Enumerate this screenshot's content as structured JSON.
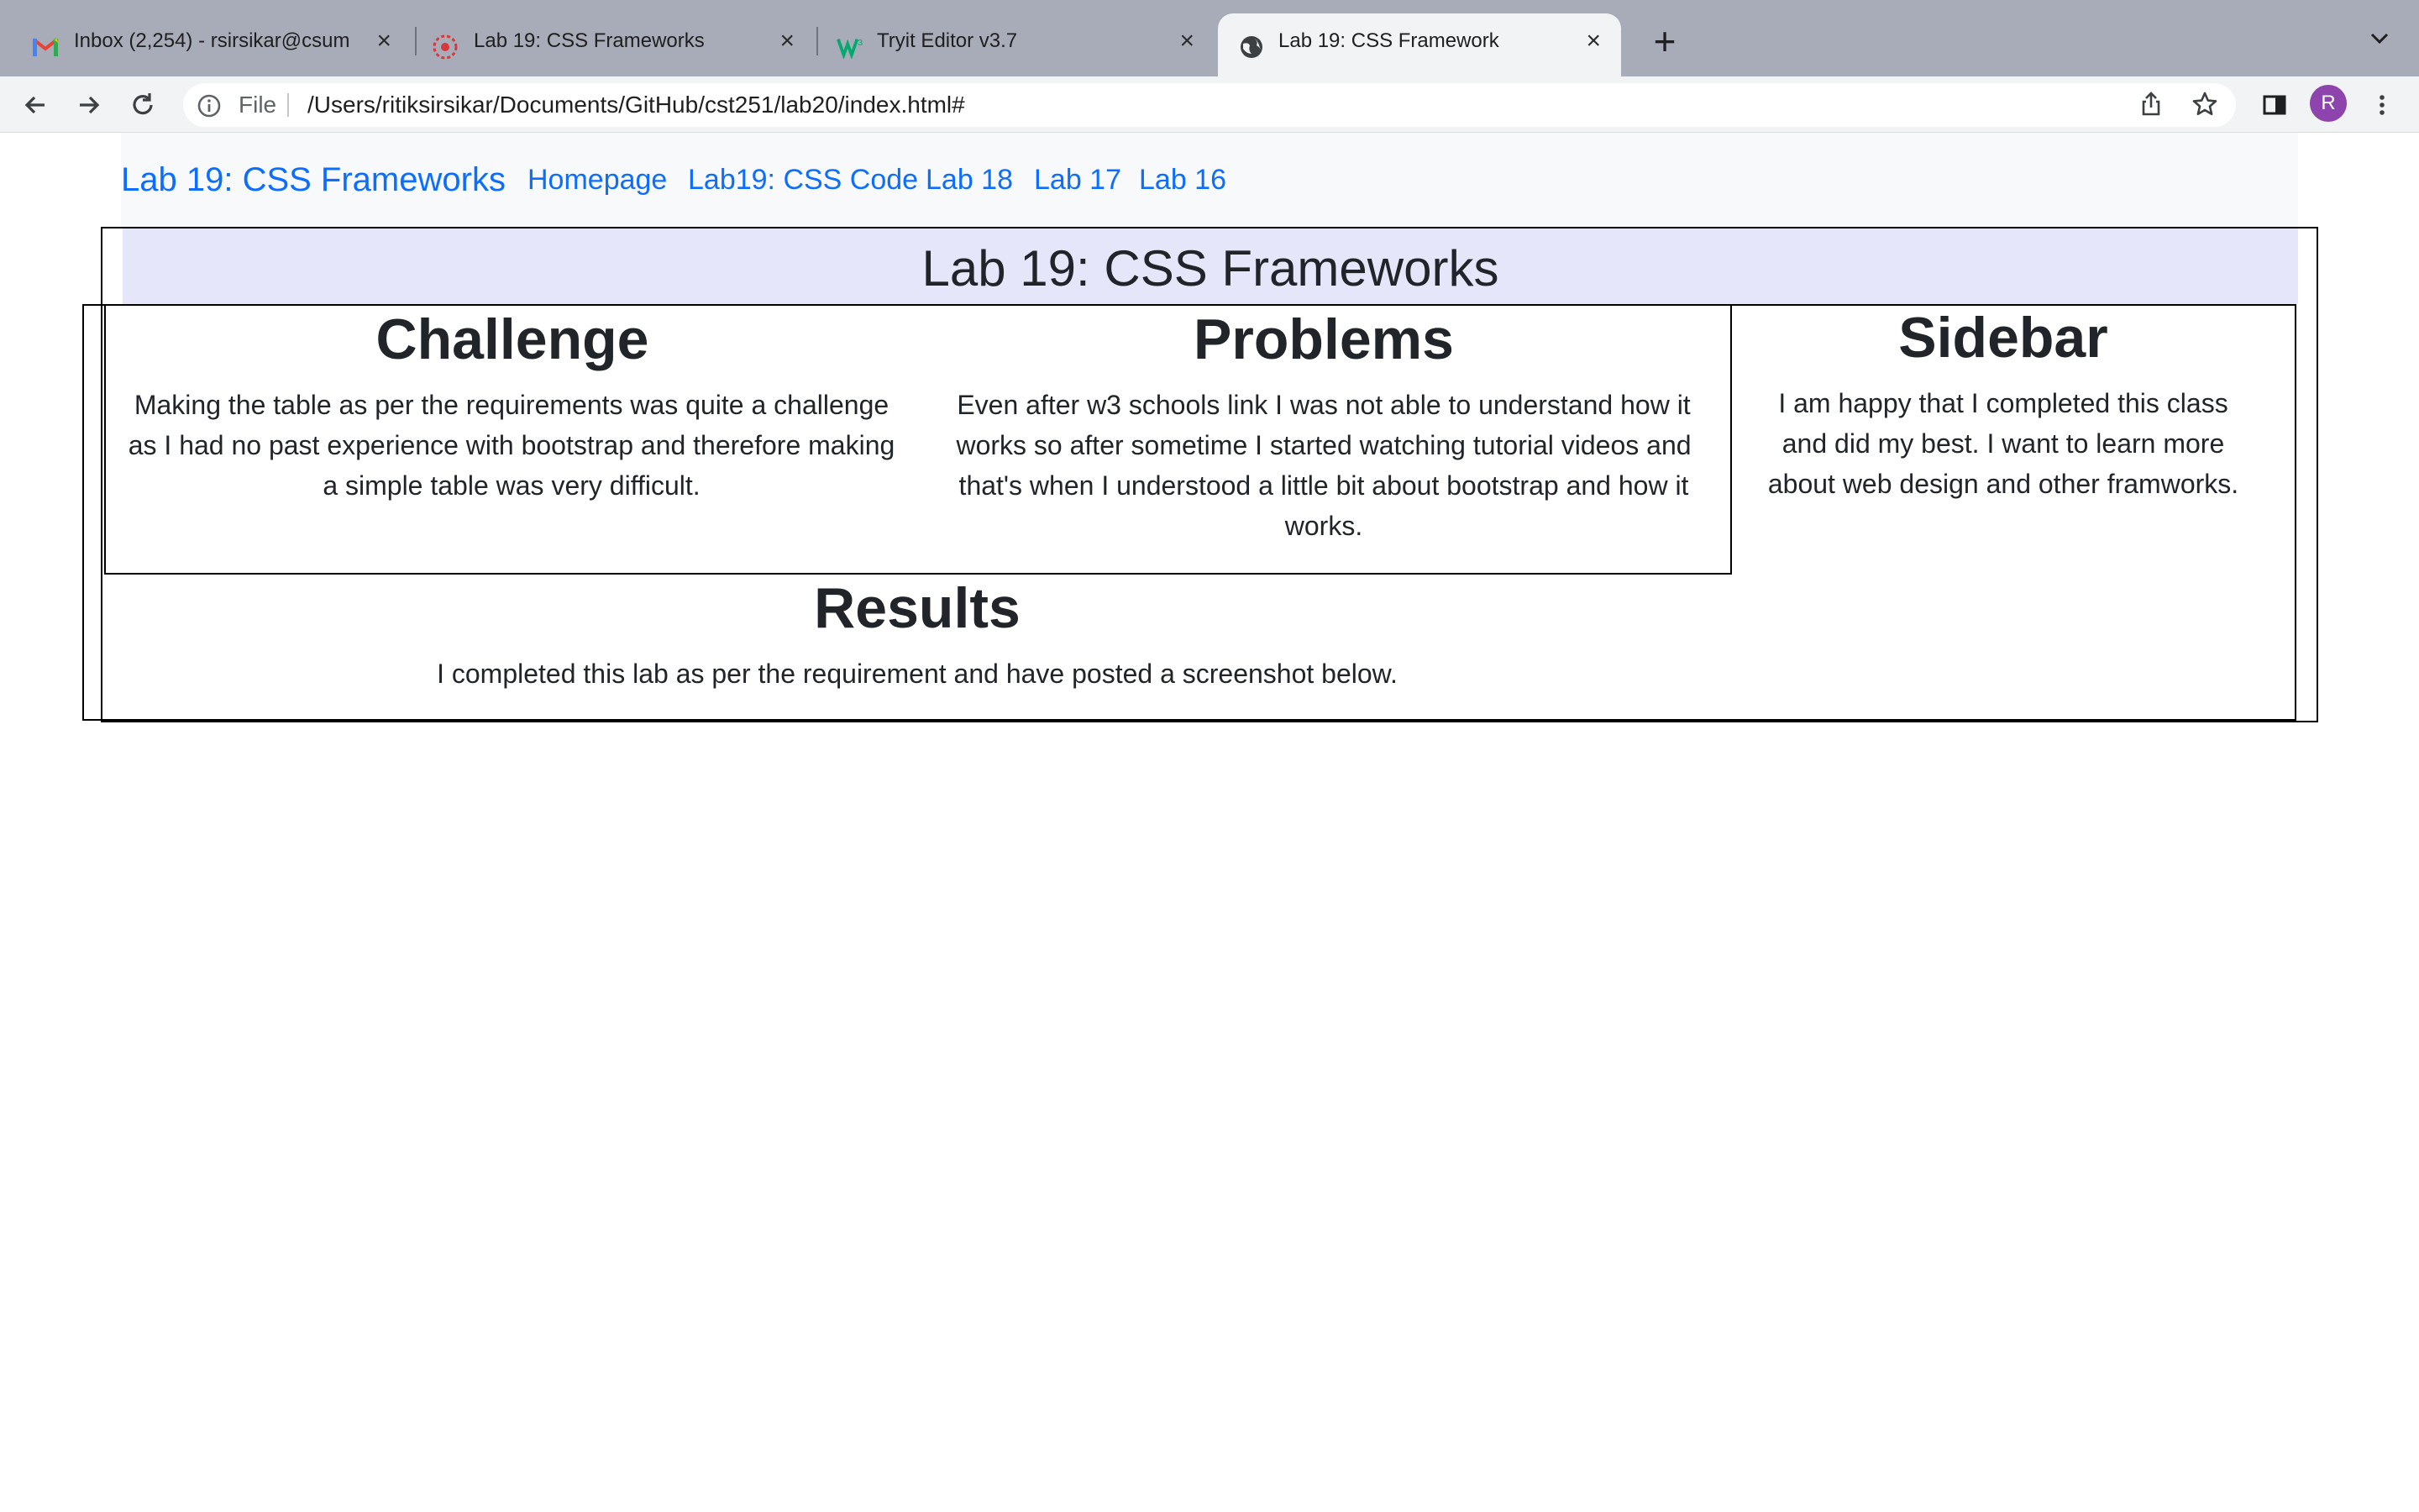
{
  "tabs": [
    {
      "title": "Inbox (2,254) - rsirsikar@csum",
      "icon": "gmail-icon"
    },
    {
      "title": "Lab 19: CSS Frameworks",
      "icon": "csumb-icon"
    },
    {
      "title": "Tryit Editor v3.7",
      "icon": "w3schools-icon"
    },
    {
      "title": "Lab 19: CSS Framework",
      "icon": "globe-icon"
    }
  ],
  "new_tab_label": "+",
  "tab_close_glyph": "×",
  "address_bar": {
    "scheme_label": "File",
    "url": "/Users/ritiksirsikar/Documents/GitHub/cst251/lab20/index.html#"
  },
  "profile_initial": "R",
  "colors": {
    "accent": "#0d6efd",
    "title_bg": "#e6e6fa",
    "navbar_bg": "#f8f9fa",
    "profile": "#8e44ad"
  },
  "page": {
    "navbar": {
      "brand": "Lab 19: CSS Frameworks",
      "links": [
        "Homepage",
        "Lab19: CSS Code",
        "Lab 18",
        "Lab 17",
        "Lab 16"
      ]
    },
    "title": "Lab 19: CSS Frameworks",
    "challenge": {
      "heading": "Challenge",
      "text": "Making the table as per the requirements was quite a challenge as I had no past experience with bootstrap and therefore making a simple table was very difficult."
    },
    "problems": {
      "heading": "Problems",
      "text": "Even after w3 schools link I was not able to understand how it works so after sometime I started watching tutorial videos and that's when I understood a little bit about bootstrap and how it works."
    },
    "sidebar": {
      "heading": "Sidebar",
      "text": "I am happy that I completed this class and did my best. I want to learn more about web design and other framworks."
    },
    "results": {
      "heading": "Results",
      "text": "I completed this lab as per the requirement and have posted a screenshot below."
    }
  }
}
